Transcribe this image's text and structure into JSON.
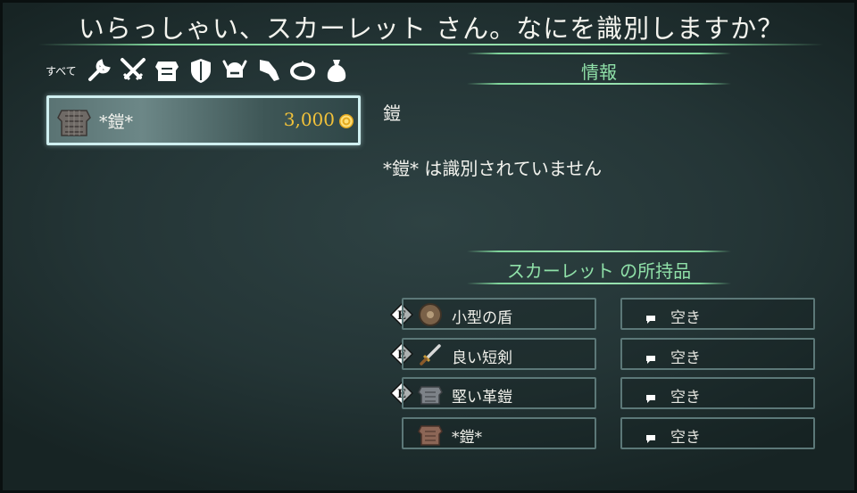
{
  "title": "いらっしゃい、スカーレット さん。なにを識別しますか？",
  "categories": {
    "all_label": "すべて",
    "icons": [
      "tools-icon",
      "weapon-icon",
      "armor-icon",
      "shield-icon",
      "helmet-icon",
      "gauntlet-icon",
      "ring-icon",
      "pouch-icon"
    ]
  },
  "item_list": [
    {
      "name": "*鎧*",
      "price": "3,000",
      "icon": "armor-icon"
    }
  ],
  "info": {
    "header": "情報",
    "item_name": "鎧",
    "description": "*鎧* は識別されていません"
  },
  "inventory": {
    "header": "スカーレット の所持品",
    "equip_badge": "E",
    "left": [
      {
        "label": "小型の盾",
        "icon": "small-shield-icon",
        "equipped": true
      },
      {
        "label": "良い短剣",
        "icon": "dagger-icon",
        "equipped": true
      },
      {
        "label": "堅い革鎧",
        "icon": "leather-armor-icon",
        "equipped": true
      },
      {
        "label": "*鎧*",
        "icon": "armor-icon",
        "equipped": false
      }
    ],
    "right": [
      {
        "label": "空き"
      },
      {
        "label": "空き"
      },
      {
        "label": "空き"
      },
      {
        "label": "空き"
      }
    ]
  },
  "colors": {
    "accent_green": "#8fe0a8",
    "price_gold": "#f2c23a",
    "selection_border": "#cfeff0"
  }
}
